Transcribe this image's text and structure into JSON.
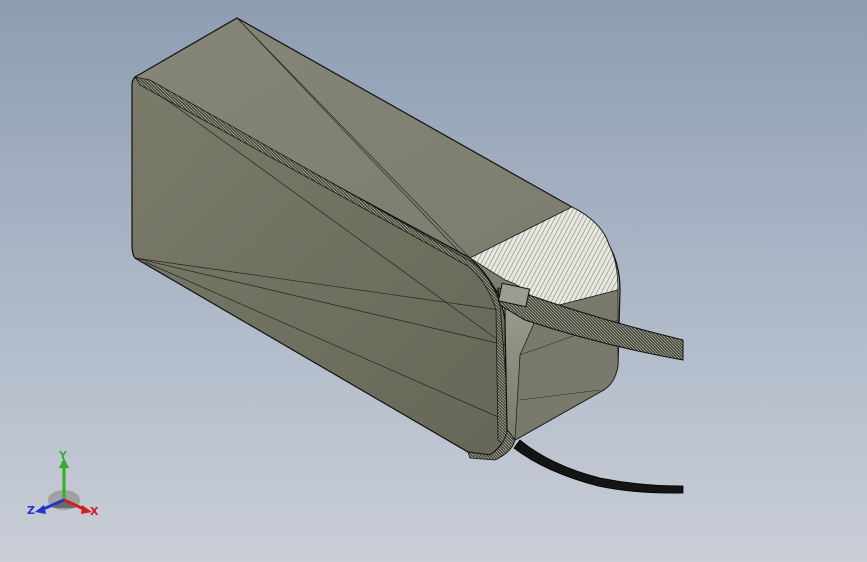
{
  "viewport": {
    "background_top": "#8e9db2",
    "background_bottom": "#c9ced7"
  },
  "model": {
    "face_color": "#6e6e5e",
    "top_color": "#858577",
    "end_color": "#9a9a8c",
    "cable_color": "#1a1a1a"
  },
  "triad": {
    "y_label": "Y",
    "z_label": "Z",
    "x_label": "X",
    "y_color": "#2fb02f",
    "z_color": "#2233cc",
    "x_color": "#cc2020"
  }
}
